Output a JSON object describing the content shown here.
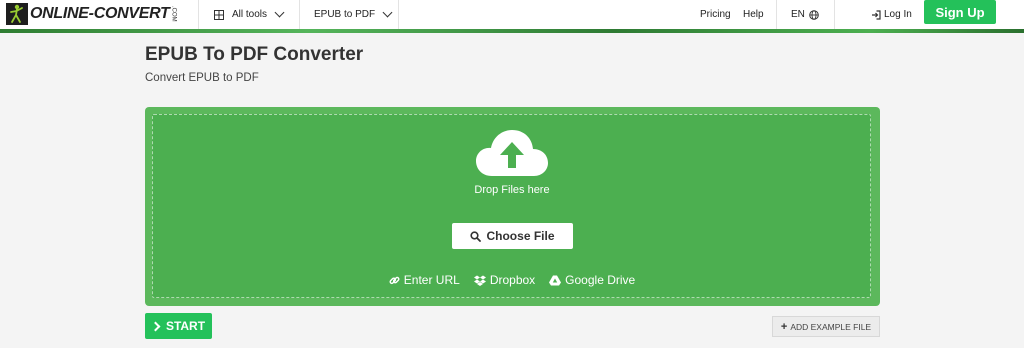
{
  "header": {
    "logo_text_left": "ONLINE-",
    "logo_text_right": "CONVERT",
    "logo_com": ".COM",
    "all_tools_label": "All tools",
    "epub_to_pdf_label": "EPUB to PDF",
    "pricing_label": "Pricing",
    "help_label": "Help",
    "language_label": "EN",
    "login_label": "Log In",
    "signup_label": "Sign Up"
  },
  "main": {
    "title": "EPUB To PDF Converter",
    "subtitle": "Convert EPUB to PDF",
    "drop_text": "Drop Files here",
    "choose_file_label": "Choose File",
    "sources": [
      {
        "label": "Enter URL",
        "icon": "link-icon"
      },
      {
        "label": "Dropbox",
        "icon": "dropbox-icon"
      },
      {
        "label": "Google Drive",
        "icon": "google-drive-icon"
      }
    ],
    "start_label": "START",
    "add_example_label": "ADD EXAMPLE FILE"
  },
  "colors": {
    "brand_green": "#24c15a",
    "drop_outer": "#5cb85c",
    "drop_inner": "#4caf50",
    "page_bg": "#f4f4f4"
  }
}
